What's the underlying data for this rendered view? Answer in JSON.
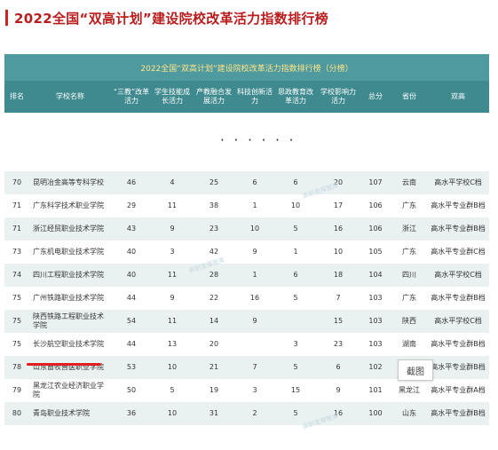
{
  "heading": "2022全国“双高计划”建设院校改革活力指数排行榜",
  "table": {
    "title": "2022全国“双高计划”建设院校改革活力指数排行榜（分榜）",
    "headers": [
      "排名",
      "学校名称",
      "“三教”改革活力",
      "学生技能成长活力",
      "产教融合发展活力",
      "科技创新活力",
      "思政教育改革活力",
      "学校影响力活力",
      "总分",
      "省份",
      "双高"
    ],
    "ellipsis": "· · · · · ·",
    "rows": [
      [
        "70",
        "昆明冶金高等专科学校",
        "46",
        "4",
        "25",
        "6",
        "6",
        "20",
        "107",
        "云南",
        "高水平学校C档"
      ],
      [
        "71",
        "广东科学技术职业学院",
        "29",
        "11",
        "38",
        "1",
        "10",
        "17",
        "106",
        "广东",
        "高水平专业群B档"
      ],
      [
        "71",
        "浙江经贸职业技术学院",
        "43",
        "9",
        "23",
        "10",
        "5",
        "16",
        "106",
        "浙江",
        "高水平专业群B档"
      ],
      [
        "73",
        "广东机电职业技术学院",
        "40",
        "3",
        "42",
        "9",
        "1",
        "10",
        "105",
        "广东",
        "高水平专业群C档"
      ],
      [
        "74",
        "四川工程职业技术学院",
        "40",
        "11",
        "28",
        "1",
        "6",
        "18",
        "104",
        "四川",
        "高水平学校C档"
      ],
      [
        "75",
        "广州铁路职业技术学院",
        "44",
        "9",
        "22",
        "16",
        "5",
        "7",
        "103",
        "广东",
        "高水平专业群B档"
      ],
      [
        "75",
        "陕西铁路工程职业技术学院",
        "54",
        "11",
        "14",
        "9",
        "",
        "15",
        "103",
        "陕西",
        "高水平学校C档"
      ],
      [
        "75",
        "长沙航空职业技术学院",
        "44",
        "13",
        "20",
        "",
        "3",
        "23",
        "103",
        "湖南",
        "高水平专业群B档"
      ],
      [
        "78",
        "山东畜牧兽医职业学院",
        "53",
        "10",
        "21",
        "7",
        "5",
        "6",
        "102",
        "山东",
        "高水平专业群B档"
      ],
      [
        "79",
        "黑龙江农业经济职业学院",
        "50",
        "5",
        "19",
        "3",
        "15",
        "9",
        "101",
        "黑龙江",
        "高水平专业群A档"
      ],
      [
        "80",
        "青岛职业技术学院",
        "36",
        "10",
        "31",
        "2",
        "5",
        "16",
        "100",
        "山东",
        "高水平专业群B档"
      ]
    ]
  },
  "watermark": "高职发展智库",
  "callout": "截图"
}
